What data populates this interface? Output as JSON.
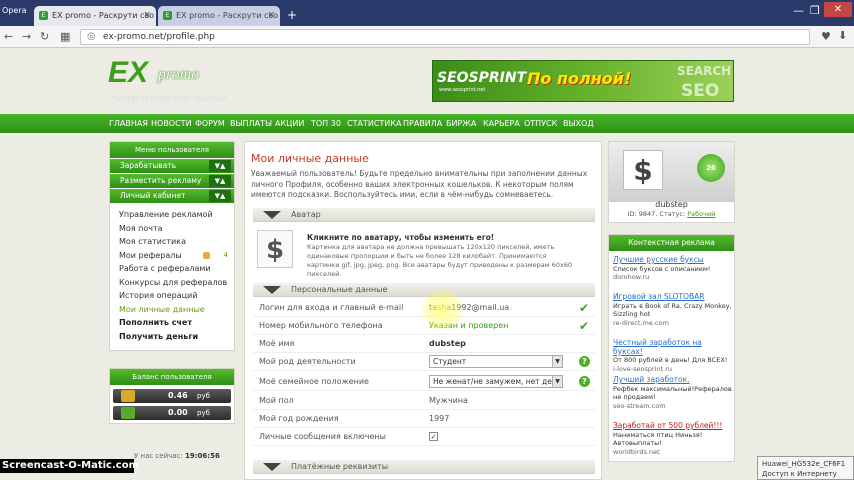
{
  "browser": {
    "menu_label": "Opera",
    "tabs": [
      {
        "label": "EX promo - Раскрути сво",
        "close": "×"
      },
      {
        "label": "EX promo - Раскрути сво",
        "close": "×"
      }
    ],
    "new_tab": "+",
    "url": "ex-promo.net/profile.php",
    "win_min": "—",
    "win_max": "❐",
    "win_close": "✕"
  },
  "site": {
    "logo_ex": "EX",
    "logo_promo": "promo",
    "slogan": "Раскрути свой сайт вместе!",
    "banner": {
      "brand": "SEOSPRINT",
      "brand_url": "www.seosprint.net",
      "slogan": "По полной!",
      "seo_top": "SEARCH",
      "seo_bottom": "SEO"
    },
    "nav": [
      "ГЛАВНАЯ",
      "НОВОСТИ",
      "ФОРУМ",
      "ВЫПЛАТЫ",
      "АКЦИИ",
      "ТОП 30",
      "СТАТИСТИКА",
      "ПРАВИЛА",
      "БИРЖА",
      "КАРЬЕРА",
      "ОТПУСК",
      "ВЫХОД"
    ]
  },
  "sidebar": {
    "title": "Меню пользователя",
    "sections": [
      {
        "label": "Зарабатывать"
      },
      {
        "label": "Разместить рекламу"
      },
      {
        "label": "Личный кабинет"
      }
    ],
    "links": [
      {
        "label": "Управление рекламой"
      },
      {
        "label": "Моя почта"
      },
      {
        "label": "Моя статистика"
      },
      {
        "label": "Мои рефералы",
        "badge": "4"
      },
      {
        "label": "Работа с рефералами"
      },
      {
        "label": "Конкурсы для рефералов"
      },
      {
        "label": "История операций"
      },
      {
        "label": "Мои личные данные"
      },
      {
        "label": "Пополнить счет"
      },
      {
        "label": "Получить деньги"
      }
    ]
  },
  "balance": {
    "title": "Баланс пользователя",
    "rows": [
      {
        "value": "0.46",
        "unit": "руб"
      },
      {
        "value": "0.00",
        "unit": "руб"
      }
    ],
    "online_label": "У нас сейчас:",
    "online_time": "19:06:56"
  },
  "main": {
    "title": "Мои личные данные",
    "intro": "Уважаемый пользователь! Будьте предельно внимательны при заполнении данных личного Профиля, особенно ваших электронных кошельков. К некоторым полям имеются подсказки. Воспользуйтесь ими, если в чём-нибудь сомневаетесь.",
    "section_avatar": "Аватар",
    "avatar_title": "Кликните по аватару, чтобы изменить его!",
    "avatar_desc": "Картинка для аватара не должна превышать 120x120 пикселей, иметь одинаковые пропорции и быть не более 128 килобайт. Принимаются картинки gif, jpg, jpeg, png. Все аватары будут приведены к размерам 60x60 пикселей.",
    "section_personal": "Персональные данные",
    "fields": {
      "login_label": "Логин для входа и главный e-mail",
      "login_value": "tasha1992@mail.ua",
      "phone_label": "Номер мобильного телефона",
      "phone_value": "Указан и проверен",
      "name_label": "Моё имя",
      "name_value": "dubstep",
      "activity_label": "Мой род деятельности",
      "activity_value": "Студент",
      "marital_label": "Моё семейное положение",
      "marital_value": "Не женат/не замужем, нет детей",
      "gender_label": "Мой пол",
      "gender_value": "Мужчина",
      "year_label": "Мой год рождения",
      "year_value": "1997",
      "messages_label": "Личные сообщения включены",
      "messages_checked": "✓"
    },
    "section_payment": "Платёжные реквизиты"
  },
  "profile": {
    "avatar_glyph": "$",
    "level": "26",
    "name": "dubstep",
    "id_text": "ID: 9847, Статус:",
    "status": "Рабочий"
  },
  "ads": {
    "title": "Контекстная реклама",
    "items": [
      {
        "title": "Лучшие русские буксы",
        "text": "Список буксов с описанием!",
        "url": "dorohow.ru"
      },
      {
        "title": "Игровой зал SLOTOBAR",
        "text": "Играть в Book of Ra, Crazy Monkey, Sizzling hot",
        "url": "re-direct.me.com"
      },
      {
        "title": "Честный заработок на буксах!",
        "text": "От 800 рублей в день! Для ВСЕХ!",
        "url": "i-love-seosprint.ru"
      },
      {
        "title": "Лучший заработок.",
        "text": "Рефбек максимальный!Рефералов не продаем!",
        "url": "seo-stream.com"
      },
      {
        "title": "Заработай от 500 рублей!!!",
        "text": "Наниматься птиц Ниньзя! Автовыплаты!",
        "url": "worldbirds.net"
      }
    ]
  },
  "overlay": {
    "watermark": "Screencast-O-Matic.com",
    "wifi_name": "Huawei_HG532e_CF6F1",
    "wifi_status": "Доступ к Интернету"
  }
}
